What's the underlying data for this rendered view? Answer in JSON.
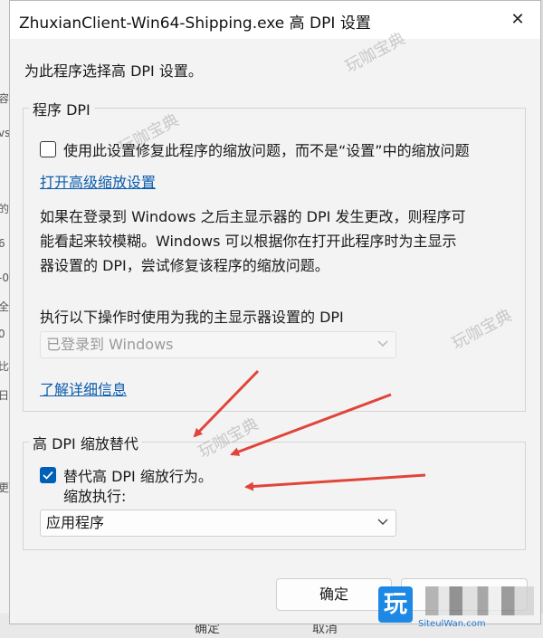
{
  "background": {
    "left_edge_glyphs": [
      "容",
      "vs",
      "的",
      "6",
      "-0",
      "全",
      "0",
      "比",
      "日",
      "更"
    ],
    "bottom_left": "确定",
    "bottom_right": "取消"
  },
  "dialog": {
    "title": "ZhuxianClient-Win64-Shipping.exe 高 DPI 设置",
    "close_glyph": "✕",
    "intro": "为此程序选择高 DPI 设置。",
    "program_dpi": {
      "legend": "程序 DPI",
      "checkbox_label": "使用此设置修复此程序的缩放问题，而不是“设置”中的缩放问题",
      "checkbox_checked": false,
      "advanced_link": "打开高级缩放设置",
      "paragraph": [
        "如果在登录到 Windows 之后主显示器的 DPI 发生更改，则程序可",
        "能看起来较模糊。Windows 可以根据你在打开此程序时为主显示",
        "器设置的 DPI，尝试修复该程序的缩放问题。"
      ],
      "select_label": "执行以下操作时使用为我的主显示器设置的 DPI",
      "select_value": "已登录到 Windows",
      "learn_more_link": "了解详细信息"
    },
    "override": {
      "legend": "高 DPI 缩放替代",
      "checkbox_label": "替代高 DPI 缩放行为。",
      "checkbox_checked": true,
      "sub_label": "缩放执行:",
      "select_value": "应用程序"
    },
    "ok_button": "确定"
  },
  "watermark": "玩咖宝典",
  "logo": {
    "glyph": "玩",
    "url_text": "SiteulWan.com"
  },
  "colors": {
    "accent": "#005fb8",
    "link": "#0b5cad",
    "arrow": "#e0453a"
  }
}
